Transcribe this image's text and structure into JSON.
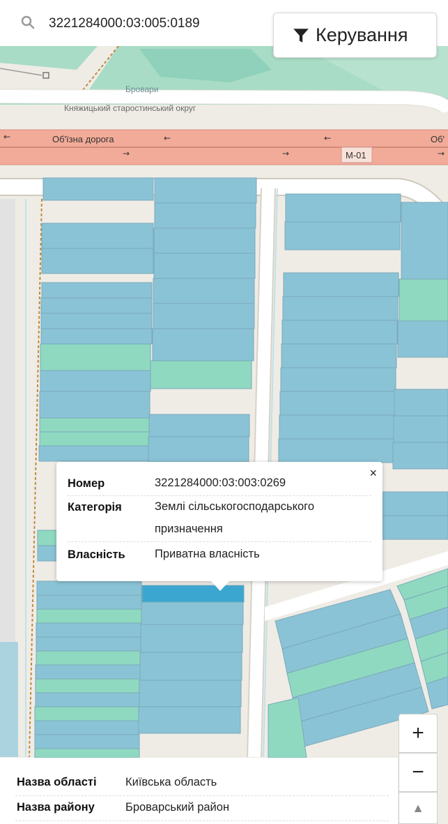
{
  "search": {
    "value": "3221284000:03:005:0189",
    "icon": "search-icon"
  },
  "control_button": {
    "label": "Керування",
    "icon": "filter-icon"
  },
  "map": {
    "labels": {
      "city": "Бровари",
      "district": "Княжицький старостинський округ",
      "road_name": "Об'їзна дорога",
      "road_name_cut_right": "Об'",
      "road_ref": "М-01"
    },
    "colors": {
      "background": "#efece6",
      "park": "#a8dcc6",
      "water": "#aad3df",
      "road_trunk": "#f2ab98",
      "parcel_blue": "#8bc3d6",
      "parcel_green": "#8fd9c0",
      "parcel_selected": "#3ba6d0"
    }
  },
  "popup": {
    "close": "×",
    "rows": [
      {
        "key": "Номер",
        "value": [
          "3221284000:03:003:0269"
        ]
      },
      {
        "key": "Категорія",
        "value": [
          "Землі сільськогосподарського",
          "призначення"
        ]
      },
      {
        "key": "Власність",
        "value": [
          "Приватна власність"
        ]
      }
    ]
  },
  "zoom": {
    "in": "+",
    "out": "−",
    "compass": "▲"
  },
  "info_panel": {
    "rows": [
      {
        "key": "Назва області",
        "value": "Київська область"
      },
      {
        "key": "Назва району",
        "value": "Броварський район"
      }
    ]
  }
}
